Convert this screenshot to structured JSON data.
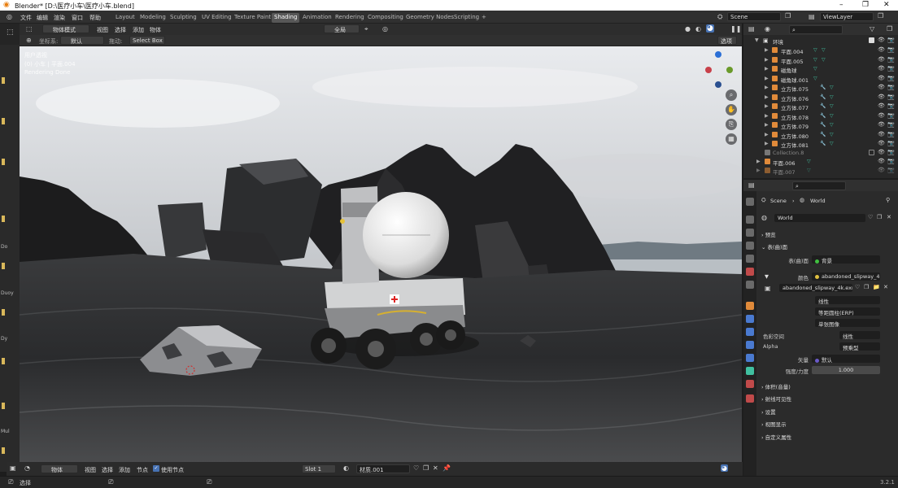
{
  "window": {
    "title": "Blender* [D:\\医疗小车\\医疗小车.blend]",
    "minimize": "–",
    "maximize": "❐",
    "close": "✕"
  },
  "menu": {
    "file": "文件",
    "edit": "编辑",
    "render": "渲染",
    "window": "窗口",
    "help": "帮助"
  },
  "workspaces": [
    "Layout",
    "Modeling",
    "Sculpting",
    "UV Editing",
    "Texture Paint",
    "Shading",
    "Animation",
    "Rendering",
    "Compositing",
    "Geometry Nodes",
    "Scripting",
    "+"
  ],
  "active_workspace": "Shading",
  "scene": {
    "name": "Scene",
    "view_layer": "ViewLayer"
  },
  "viewport_header": {
    "mode": "物体模式",
    "view": "视图",
    "select": "选择",
    "add": "添加",
    "object": "物体",
    "orientation_label": "坐标系:",
    "orientation": "默认",
    "drag_label": "拖动:",
    "drag": "Select Box",
    "pivot": "全局",
    "options": "选项"
  },
  "viewport_overlay": {
    "line1": "用户透视",
    "line2": "(0) 小车 | 平面.004",
    "line3": "Rendering Done"
  },
  "left_labels": [
    "Do",
    "Duoy",
    "Dy",
    "Mul"
  ],
  "viewport_footer": {
    "mode": "物体",
    "view": "视图",
    "select": "选择",
    "add": "添加",
    "node": "节点",
    "use_nodes": "使用节点",
    "slot": "Slot 1",
    "material": "材质.001"
  },
  "statusbar": {
    "select": "选择",
    "version": "3.2.1"
  },
  "outliner": {
    "root": "环境",
    "items": [
      {
        "name": "平面.004"
      },
      {
        "name": "平面.005"
      },
      {
        "name": "磁角球"
      },
      {
        "name": "磁角球.001"
      },
      {
        "name": "立方体.075"
      },
      {
        "name": "立方体.076"
      },
      {
        "name": "立方体.077"
      },
      {
        "name": "立方体.078"
      },
      {
        "name": "立方体.079"
      },
      {
        "name": "立方体.080"
      },
      {
        "name": "立方体.081"
      }
    ],
    "collection": "Collection.8",
    "after": [
      {
        "name": "平面.006"
      },
      {
        "name": "平面.007"
      }
    ]
  },
  "properties": {
    "breadcrumb_scene": "Scene",
    "breadcrumb_world": "World",
    "world_name": "World",
    "sections": {
      "preview": "预览",
      "surface": "表(曲)面",
      "volume": "体积(音量)",
      "ray_visibility": "射线可见性",
      "settings": "设置",
      "viewport_display": "视图显示",
      "custom_props": "自定义属性"
    },
    "surface_label": "表(曲)面",
    "surface_value": "背景",
    "color_label": "颜色",
    "color_value": "abandoned_slipway_4k...",
    "image_name": "abandoned_slipway_4k.exr",
    "interp": "线性",
    "projection": "等距圆柱(ERP)",
    "source": "单张图像",
    "colorspace_label": "色彩空间",
    "colorspace": "线性",
    "alpha_label": "Alpha",
    "alpha": "预乘型",
    "vector_label": "矢量",
    "vector": "默认",
    "strength_label": "强度/力度",
    "strength": "1.000"
  }
}
